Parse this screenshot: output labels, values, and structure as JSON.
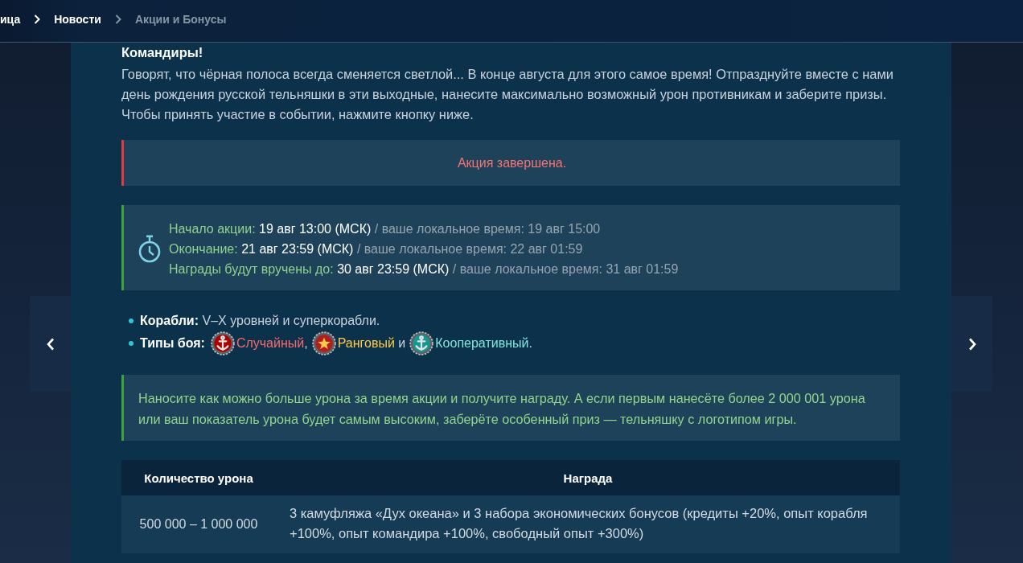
{
  "breadcrumbs": [
    {
      "label": "ица",
      "current": false
    },
    {
      "label": "Новости",
      "current": false
    },
    {
      "label": "Акции и Бонусы",
      "current": true
    }
  ],
  "article": {
    "title": "Командиры!",
    "intro": "Говорят, что чёрная полоса всегда сменяется светлой... В конце августа для этого самое время! Отпразднуйте вместе с нами день рождения русской тельняшки в эти выходные, нанесите максимально возможный урон противникам и заберите призы. Чтобы принять участие в событии, нажмите кнопку ниже.",
    "status_notice": "Акция завершена.",
    "schedule": [
      {
        "label": "Начало акции:",
        "time": "19 авг 13:00 (МСК)",
        "local": "/ ваше локальное время: 19 авг 15:00"
      },
      {
        "label": "Окончание:",
        "time": "21 авг 23:59 (МСК)",
        "local": "/ ваше локальное время: 22 авг 01:59"
      },
      {
        "label": "Награды будут вручены до:",
        "time": "30 авг 23:59 (МСК)",
        "local": "/ ваше локальное время: 31 авг 01:59"
      }
    ],
    "conditions": [
      {
        "kind": "text",
        "label": "Корабли:",
        "text": "V–X уровней и суперкорабли."
      },
      {
        "kind": "battle_types",
        "label": "Типы боя:",
        "battle_types": [
          {
            "kind": "anchor",
            "name": "Случайный",
            "suffix": ",",
            "color": "#f76b6b"
          },
          {
            "kind": "star",
            "name": "Ранговый",
            "suffix": " и",
            "color": "#ffc94a"
          },
          {
            "kind": "anchor",
            "name": "Кооперативный",
            "suffix": ".",
            "color": "#7fe6e0"
          }
        ]
      }
    ],
    "reward_note": "Наносите как можно больше урона за время акции и получите награду. А если первым нанесёте более 2 000 001 урона или ваш показатель урона будет самым высоким, заберёте особенный приз — тельняшку с логотипом игры.",
    "reward_table": {
      "columns": [
        "Количество урона",
        "Награда"
      ],
      "rows": [
        [
          "500 000 – 1 000 000",
          "3 камуфляжа «Дух океана» и 3 набора экономических бонусов (кредиты +20%, опыт корабля +100%, опыт командира +100%, свободный опыт +300%)"
        ]
      ]
    }
  }
}
